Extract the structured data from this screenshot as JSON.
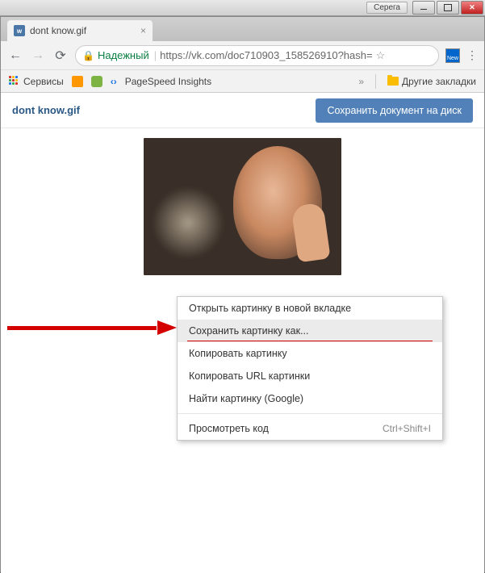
{
  "window": {
    "user_label": "Серега"
  },
  "tab": {
    "title": "dont know.gif"
  },
  "addressbar": {
    "secure_label": "Надежный",
    "url": "https://vk.com/doc710903_158526910?hash="
  },
  "ext": {
    "label": "New"
  },
  "bookmarks": {
    "services": "Сервисы",
    "pagespeed": "PageSpeed Insights",
    "chevrons": "»",
    "other": "Другие закладки"
  },
  "page": {
    "doc_title": "dont know.gif",
    "save_button": "Сохранить документ на диск"
  },
  "context_menu": {
    "open_new_tab": "Открыть картинку в новой вкладке",
    "save_as": "Сохранить картинку как...",
    "copy_image": "Копировать картинку",
    "copy_url": "Копировать URL картинки",
    "search_google": "Найти картинку (Google)",
    "inspect": "Просмотреть код",
    "inspect_shortcut": "Ctrl+Shift+I"
  }
}
